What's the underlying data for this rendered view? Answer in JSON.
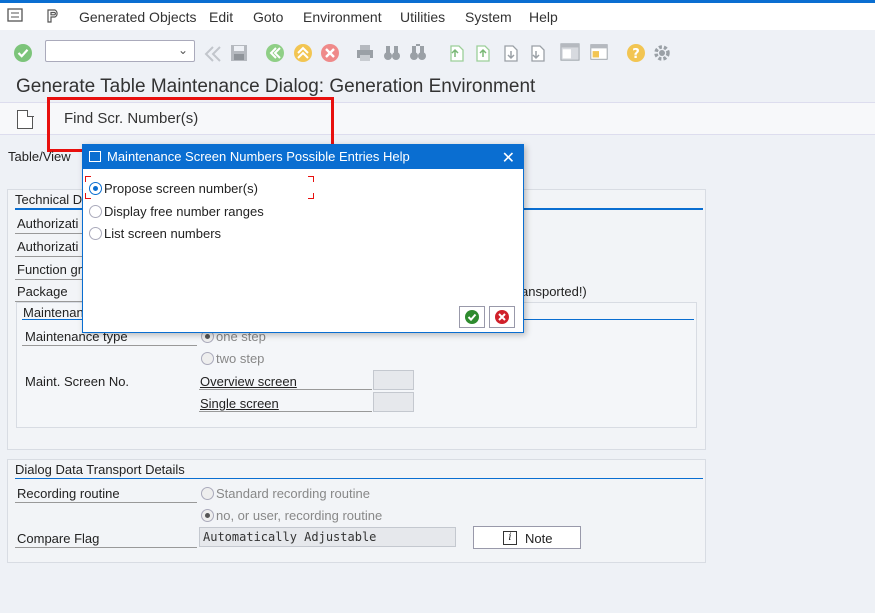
{
  "menu": {
    "items": [
      "Generated Objects",
      "Edit",
      "Goto",
      "Environment",
      "Utilities",
      "System",
      "Help"
    ]
  },
  "toolbar": {
    "command_value": "",
    "icons": [
      "enter-icon",
      "back-icon",
      "save-icon",
      "back-nav-icon",
      "exit-icon",
      "cancel-icon",
      "print-icon",
      "find-icon",
      "find-next-icon",
      "first-page-icon",
      "prev-page-icon",
      "next-page-icon",
      "last-page-icon",
      "layout-icon",
      "new-session-icon",
      "help-icon",
      "settings-icon"
    ]
  },
  "page": {
    "title": "Generate Table Maintenance Dialog: Generation Environment",
    "find_button": "Find Scr. Number(s)"
  },
  "form": {
    "table_view_label": "Table/View",
    "technical_title": "Technical D",
    "authorization1": "Authorizati",
    "authorization2": "Authorizati",
    "function_group": "Function gr",
    "package": "Package",
    "package_note": "ansported!)",
    "maintenance_title": "Maintenan",
    "maintenance_type": "Maintenance type",
    "one_step": "one step",
    "two_step": "two step",
    "maint_screen_no": "Maint. Screen No.",
    "overview_screen": "Overview screen",
    "single_screen": "Single screen",
    "overview_value": "",
    "single_value": ""
  },
  "transport": {
    "title": "Dialog Data Transport Details",
    "recording_routine": "Recording routine",
    "standard_routine": "Standard recording routine",
    "no_routine": "no, or user, recording routine",
    "compare_flag": "Compare Flag",
    "compare_value": "Automatically Adjustable",
    "note_button": "Note"
  },
  "dialog": {
    "title": "Maintenance Screen Numbers Possible Entries Help",
    "options": [
      "Propose screen number(s)",
      "Display free number ranges",
      "List screen numbers"
    ],
    "selected": 0
  },
  "colors": {
    "accent": "#0a6ed1",
    "highlight_red": "#e8100e",
    "ok_green": "#2e8b2e",
    "cancel_red": "#d0202a"
  }
}
